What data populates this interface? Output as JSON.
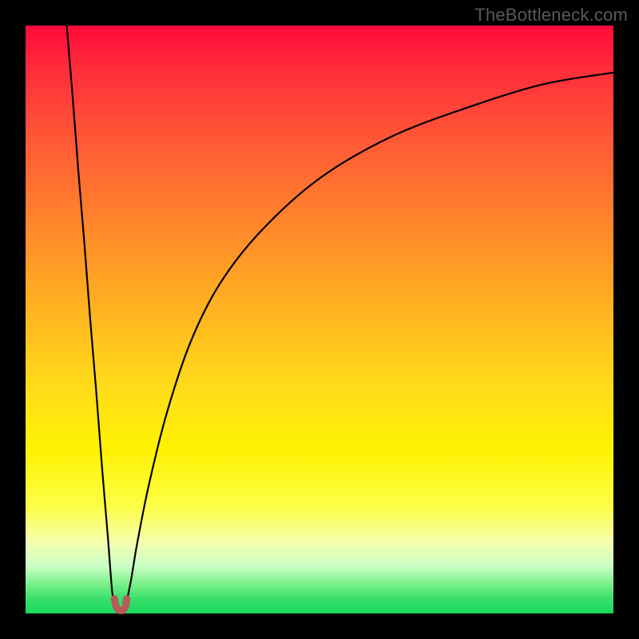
{
  "watermark": "TheBottleneck.com",
  "chart_data": {
    "type": "line",
    "title": "",
    "xlabel": "",
    "ylabel": "",
    "xlim": [
      0,
      100
    ],
    "ylim": [
      0,
      100
    ],
    "gradient_stops": [
      {
        "pos": 0,
        "color": "#ff0a3a"
      },
      {
        "pos": 8,
        "color": "#ff2f3a"
      },
      {
        "pos": 20,
        "color": "#ff5a36"
      },
      {
        "pos": 35,
        "color": "#ff8a2a"
      },
      {
        "pos": 50,
        "color": "#ffb81f"
      },
      {
        "pos": 62,
        "color": "#ffdd1a"
      },
      {
        "pos": 72,
        "color": "#fff200"
      },
      {
        "pos": 82,
        "color": "#fcff49"
      },
      {
        "pos": 88,
        "color": "#f4ffb0"
      },
      {
        "pos": 92,
        "color": "#caffc5"
      },
      {
        "pos": 95,
        "color": "#7af08a"
      },
      {
        "pos": 97.5,
        "color": "#39e06b"
      },
      {
        "pos": 100,
        "color": "#19d85c"
      }
    ],
    "series": [
      {
        "name": "left-curve",
        "color": "#000000",
        "x": [
          7,
          8,
          9,
          10,
          11,
          12,
          13,
          14,
          14.7,
          15.1
        ],
        "y": [
          100,
          88,
          75,
          63,
          50,
          38,
          25,
          13,
          4,
          2
        ]
      },
      {
        "name": "right-curve",
        "color": "#000000",
        "x": [
          17.2,
          18,
          19,
          21,
          24,
          28,
          33,
          40,
          50,
          62,
          75,
          88,
          100
        ],
        "y": [
          2,
          6,
          12,
          22,
          34,
          46,
          56,
          65,
          74,
          81,
          86,
          90,
          92
        ]
      },
      {
        "name": "dip-marker",
        "color": "#b85a57",
        "shape": "u",
        "x": [
          15.1,
          15.4,
          15.8,
          16.2,
          16.6,
          17.0,
          17.2
        ],
        "y": [
          2.5,
          1.2,
          0.6,
          0.5,
          0.6,
          1.2,
          2.5
        ]
      }
    ],
    "min_point": {
      "x": 16.2,
      "y": 0.5
    }
  }
}
